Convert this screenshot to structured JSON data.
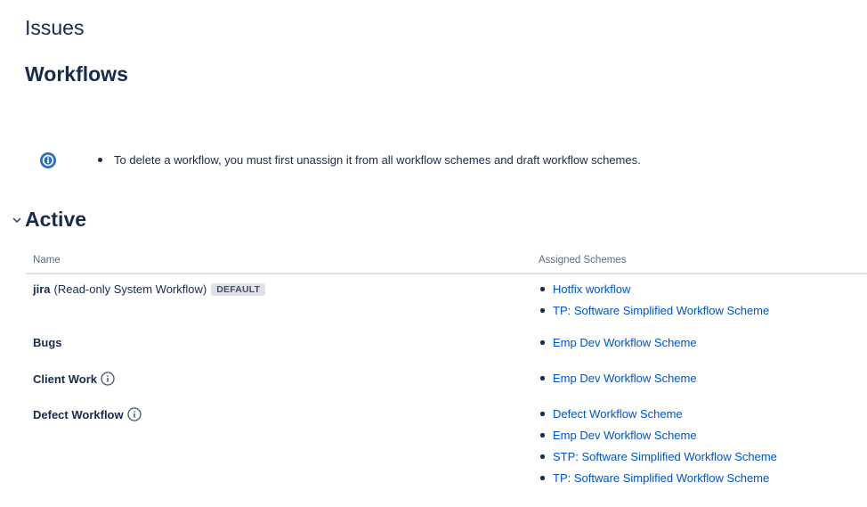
{
  "page": {
    "title": "Issues",
    "subtitle": "Workflows"
  },
  "info_message": {
    "icon": "info-icon",
    "items": [
      "To delete a workflow, you must first unassign it from all workflow schemes and draft workflow schemes."
    ]
  },
  "active_section": {
    "title": "Active",
    "toggle_icon": "chevron-down-icon",
    "columns": {
      "name": "Name",
      "assigned_schemes": "Assigned Schemes"
    },
    "rows": [
      {
        "name": "jira",
        "description": "(Read-only System Workflow)",
        "badge": "DEFAULT",
        "schemes": [
          "Hotfix workflow",
          "TP: Software Simplified Workflow Scheme"
        ]
      },
      {
        "name": "Bugs",
        "schemes": [
          "Emp Dev Workflow Scheme"
        ]
      },
      {
        "name": "Client Work",
        "has_info_icon": true,
        "schemes": [
          "Emp Dev Workflow Scheme"
        ]
      },
      {
        "name": "Defect Workflow",
        "has_info_icon": true,
        "schemes": [
          "Defect Workflow Scheme",
          "Emp Dev Workflow Scheme",
          "STP: Software Simplified Workflow Scheme",
          "TP: Software Simplified Workflow Scheme"
        ]
      }
    ]
  },
  "colors": {
    "text": "#172b4d",
    "link": "#0052cc",
    "muted": "#5e6c84",
    "info_blue": "#0052cc"
  }
}
